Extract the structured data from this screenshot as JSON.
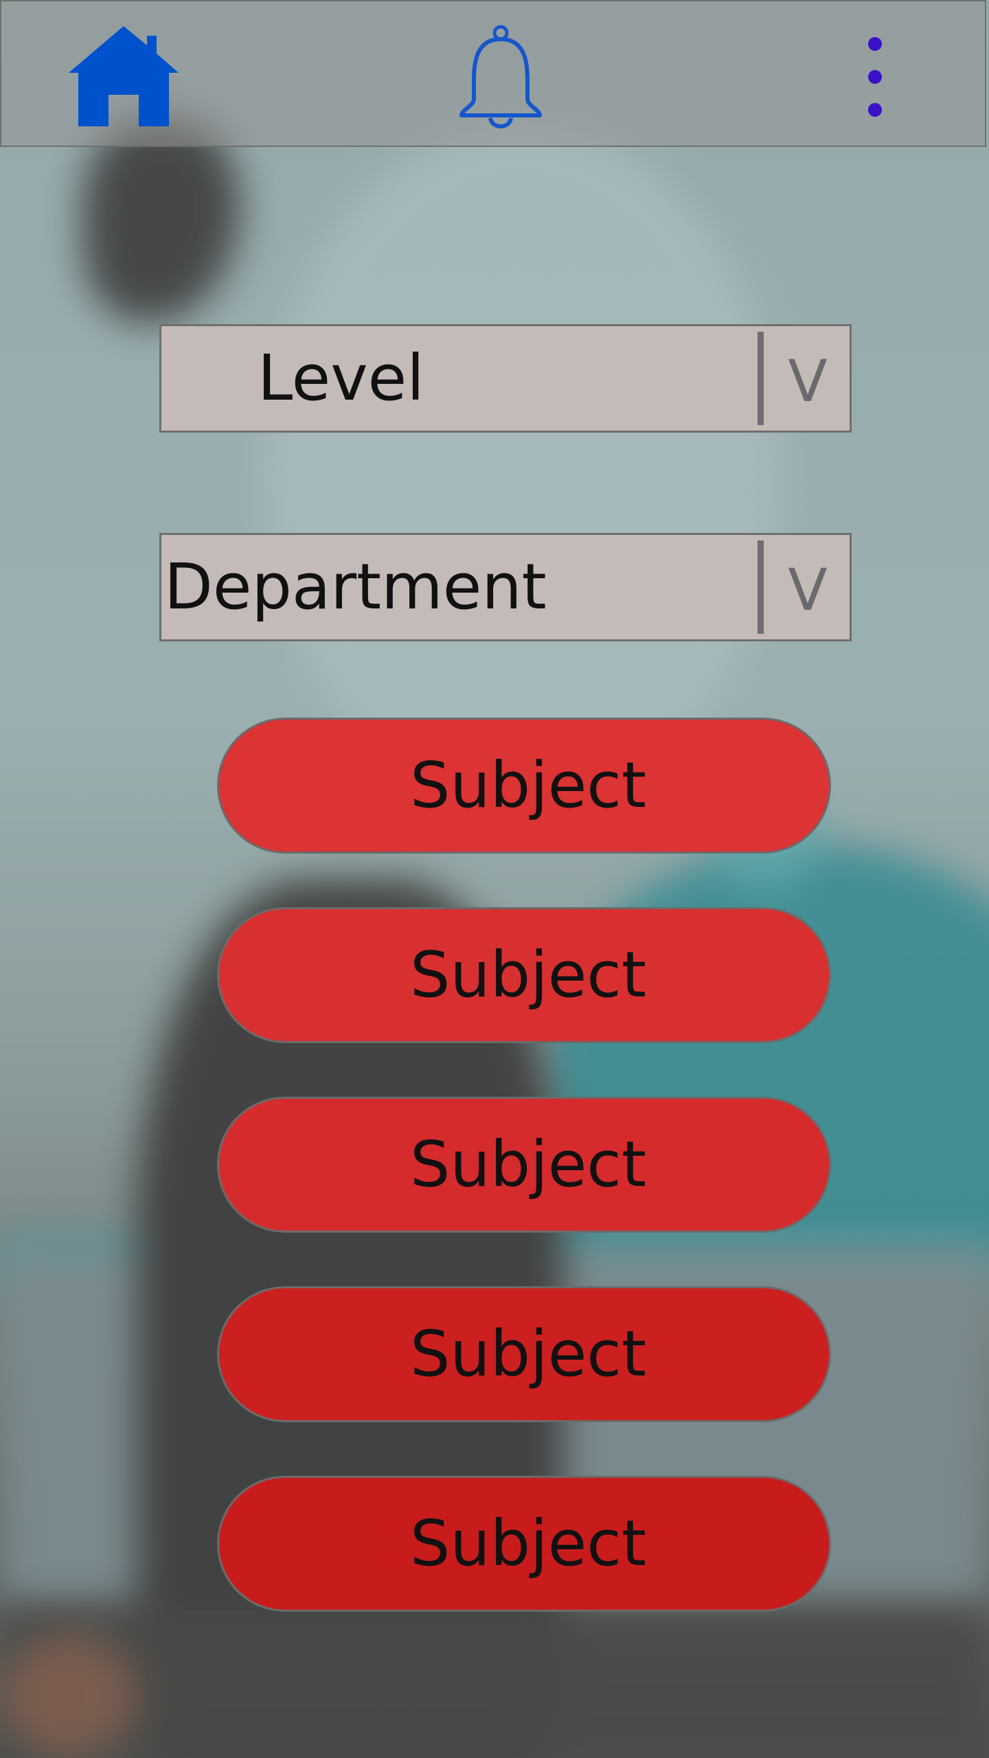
{
  "topbar": {
    "icons": [
      "home-icon",
      "bell-icon",
      "more-vertical-icon"
    ],
    "home_color": "#0051cc",
    "bell_color": "#1656cc",
    "more_color": "#3b10c9"
  },
  "filters": {
    "level": {
      "label": "Level",
      "chevron": "V"
    },
    "department": {
      "label": "Department",
      "chevron": "V"
    }
  },
  "subjects": [
    {
      "label": "Subject",
      "color": "#dc3334"
    },
    {
      "label": "Subject",
      "color": "#d83031"
    },
    {
      "label": "Subject",
      "color": "#d52b2d"
    },
    {
      "label": "Subject",
      "color": "#cc2020"
    },
    {
      "label": "Subject",
      "color": "#c81c1c"
    }
  ]
}
